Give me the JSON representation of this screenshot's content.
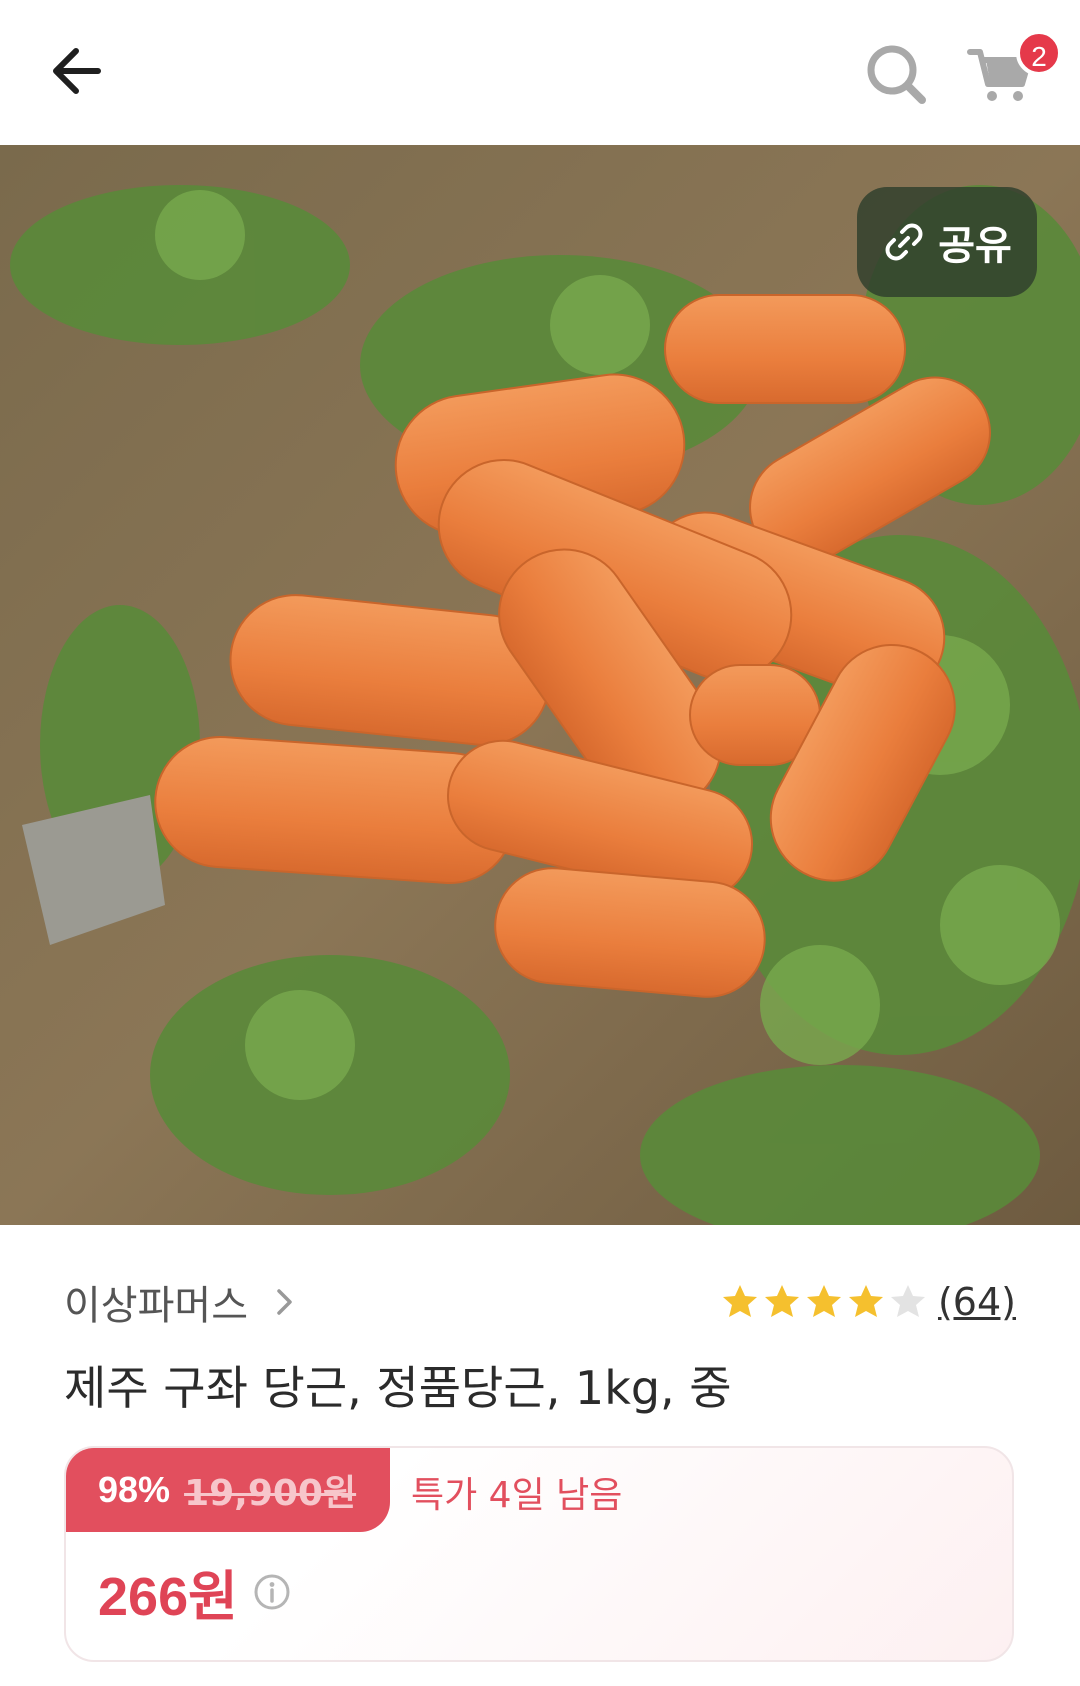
{
  "header": {
    "back_icon": "arrow-left-icon",
    "search_icon": "search-icon",
    "cart_icon": "cart-icon",
    "cart_count": "2",
    "badge_color": "#e5394a"
  },
  "image": {
    "share_label": "공유",
    "share_icon": "link-icon"
  },
  "product": {
    "seller": "이상파머스",
    "rating_value": 4,
    "rating_max": 5,
    "review_count": "(64)",
    "title": "제주 구좌 당근, 정품당근, 1kg, 중"
  },
  "price": {
    "discount_rate": "98%",
    "original_price": "19,900원",
    "special_deal": "특가 4일 남음",
    "sale_price": "266원",
    "accent_color": "#e24f5e"
  }
}
